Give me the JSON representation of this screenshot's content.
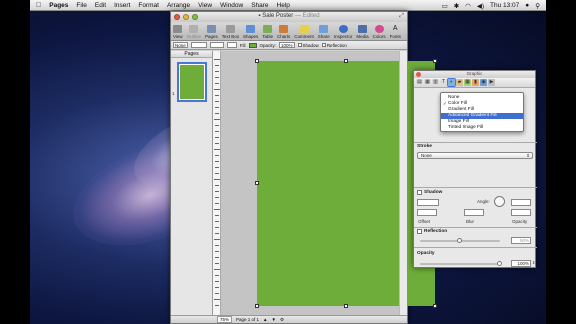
{
  "menubar": {
    "app_name": "Pages",
    "items": [
      "File",
      "Edit",
      "Insert",
      "Format",
      "Arrange",
      "View",
      "Window",
      "Share",
      "Help"
    ],
    "clock": "Thu 13:07"
  },
  "window": {
    "title": "Sale Poster",
    "title_status": "— Edited"
  },
  "toolbar": {
    "buttons": [
      {
        "label": "View",
        "icon": "view-icon",
        "color": "#8a8a8a"
      },
      {
        "label": "Outline",
        "icon": "outline-icon",
        "color": "#b0b0b0"
      },
      {
        "label": "Pages",
        "icon": "pages-icon",
        "color": "#7a8fb3"
      },
      {
        "label": "Text Box",
        "icon": "textbox-icon",
        "color": "#9a9a9a"
      },
      {
        "label": "Shapes",
        "icon": "shapes-icon",
        "color": "#5b8fd6"
      },
      {
        "label": "Table",
        "icon": "table-icon",
        "color": "#7cae56"
      },
      {
        "label": "Charts",
        "icon": "charts-icon",
        "color": "#d07a3c"
      },
      {
        "label": "Comment",
        "icon": "comment-icon",
        "color": "#e8cf4a"
      },
      {
        "label": "Share",
        "icon": "share-icon",
        "color": "#6f9fd8"
      },
      {
        "label": "Inspector",
        "icon": "inspector-icon",
        "color": "#3a6fc6"
      },
      {
        "label": "Media",
        "icon": "media-icon",
        "color": "#4c6fa8"
      },
      {
        "label": "Colors",
        "icon": "colors-icon",
        "color": "#d44a8e"
      },
      {
        "label": "Fonts",
        "icon": "fonts-icon",
        "color": "#555555"
      }
    ]
  },
  "formatbar": {
    "stroke_style": "None",
    "opacity_label": "Opacity:",
    "opacity_value": "100%",
    "shadow_label": "Shadow",
    "reflection_label": "Reflection",
    "fill_color": "#6fad3a"
  },
  "pages_pane": {
    "header": "Pages",
    "page_number": "1"
  },
  "statusbar": {
    "zoom": "75%",
    "page_info": "Page 1 of 1"
  },
  "document": {
    "page_color": "#6fad3a"
  },
  "inspector": {
    "title": "Graphic",
    "fill_options": [
      {
        "label": "None",
        "checked": false,
        "selected": false
      },
      {
        "label": "Color Fill",
        "checked": true,
        "selected": false
      },
      {
        "label": "Gradient Fill",
        "checked": false,
        "selected": false
      },
      {
        "label": "Advanced Gradient Fill",
        "checked": false,
        "selected": true
      },
      {
        "label": "Image Fill",
        "checked": false,
        "selected": false
      },
      {
        "label": "Tinted Image Fill",
        "checked": false,
        "selected": false
      }
    ],
    "stroke_label": "Stroke",
    "stroke_value": "None",
    "shadow_label": "Shadow",
    "angle_label": "Angle:",
    "offset_label": "Offset",
    "blur_label": "Blur",
    "opacity_small_label": "Opacity",
    "reflection_label": "Reflection",
    "reflection_value": "50%",
    "opacity_label": "Opacity",
    "opacity_value": "100%"
  }
}
